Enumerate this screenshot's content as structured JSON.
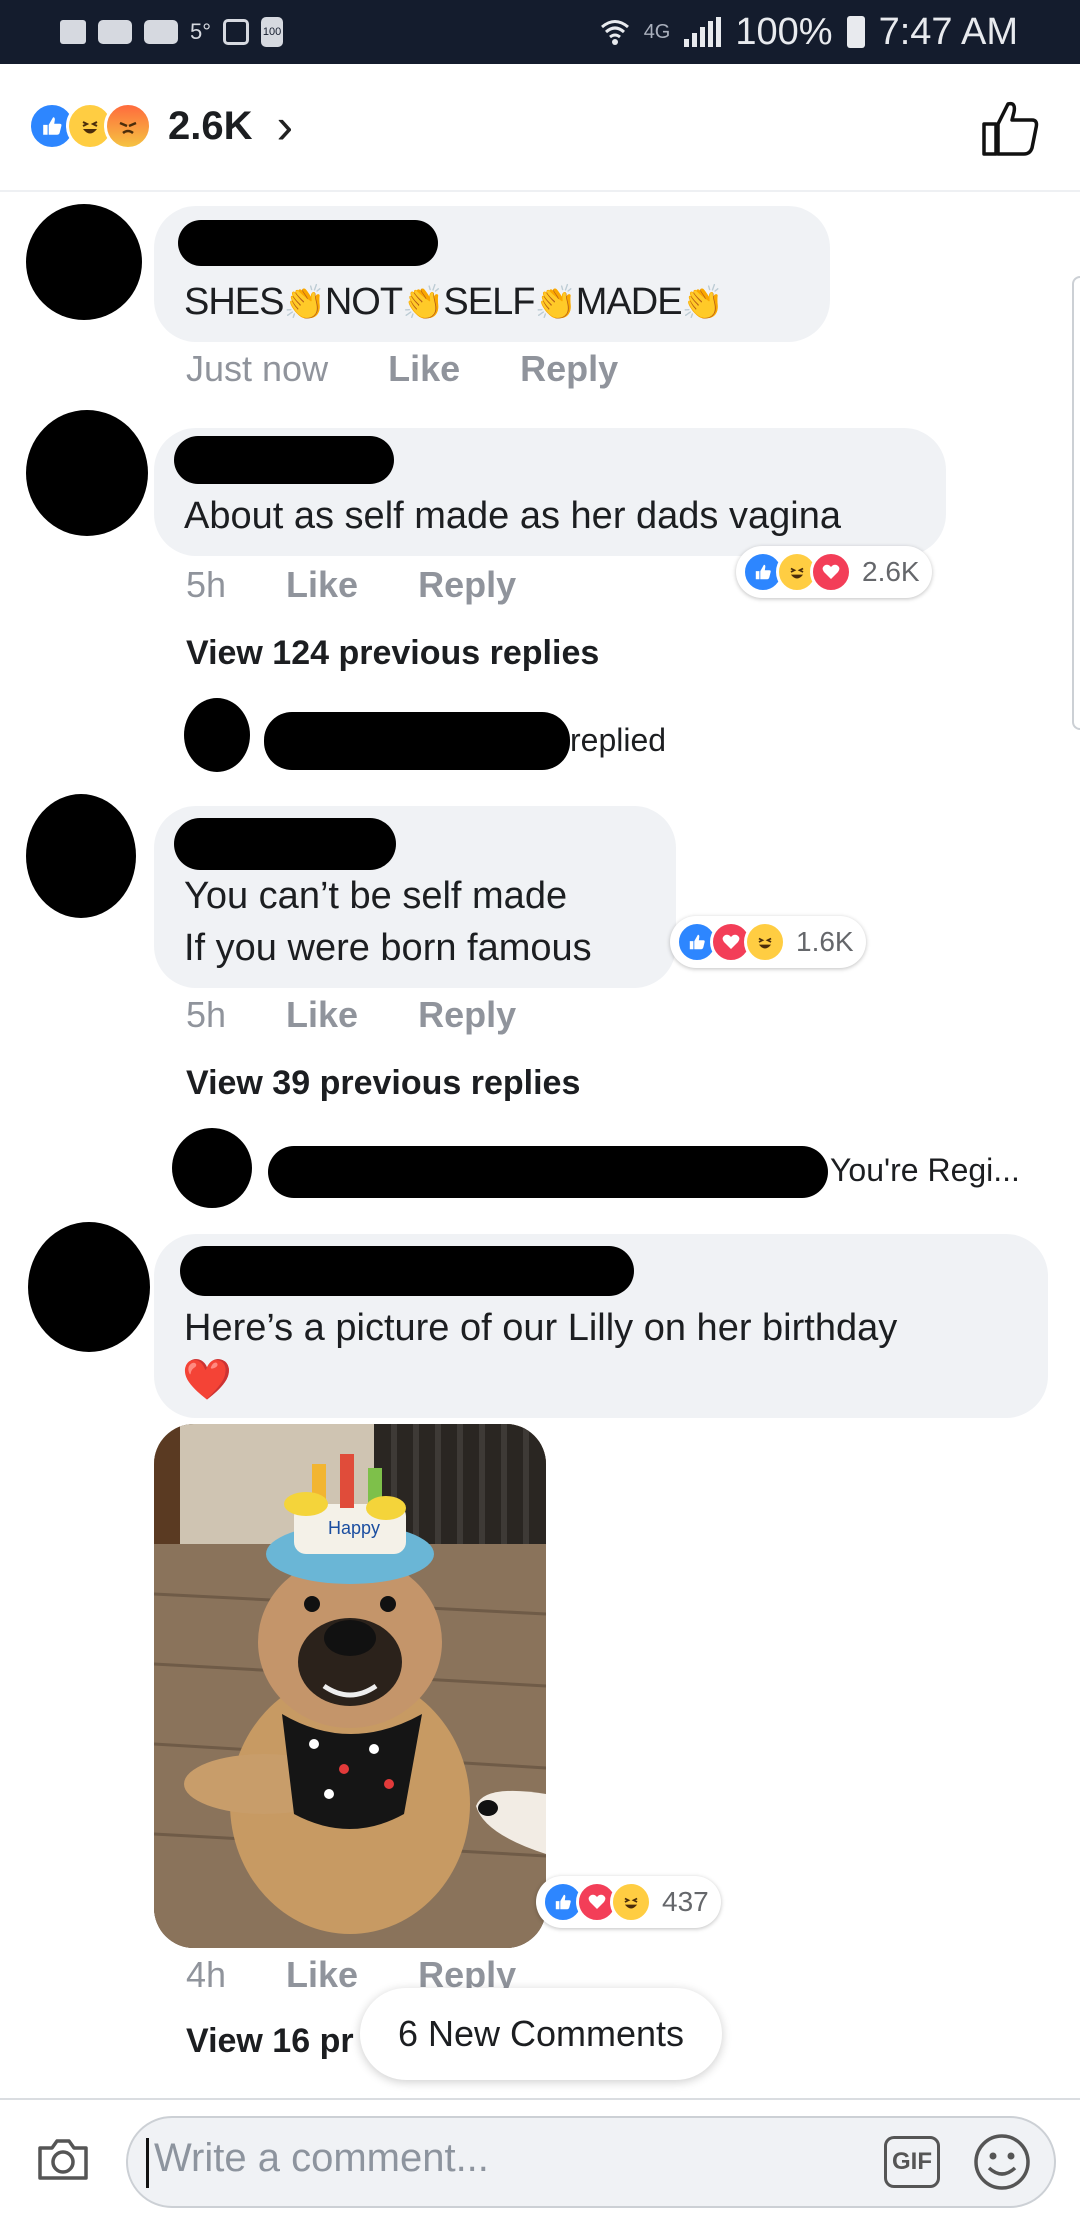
{
  "status_bar": {
    "temperature": "5°",
    "battery_small": "100",
    "network": "4G",
    "battery_percent": "100%",
    "time": "7:47 AM"
  },
  "reactions_header": {
    "count": "2.6K",
    "icons": [
      "like-icon",
      "haha-icon",
      "angry-icon"
    ]
  },
  "comments": [
    {
      "words": [
        "SHES",
        "NOT",
        "SELF",
        "MADE"
      ],
      "clap": "👏",
      "time": "Just now",
      "like": "Like",
      "reply": "Reply"
    },
    {
      "text": "About as self made as her dads vagina",
      "time": "5h",
      "like": "Like",
      "reply": "Reply",
      "reaction_count": "2.6K",
      "view_previous": "View 124 previous replies",
      "reply_snippet": "replied"
    },
    {
      "lines": [
        "You can’t be self made",
        "If you were born famous"
      ],
      "time": "5h",
      "like": "Like",
      "reply": "Reply",
      "reaction_count": "1.6K",
      "view_previous": "View 39 previous replies",
      "reply_snippet": "You're Regi..."
    },
    {
      "text": "Here’s a picture of our Lilly on her birthday",
      "heart": "❤️",
      "photo_hat_text": "Happy",
      "reaction_count": "437",
      "time": "4h",
      "like": "Like",
      "reply": "Reply",
      "view_previous": "View 16 pr"
    }
  ],
  "toast": "6 New Comments",
  "composer": {
    "placeholder": "Write a comment...",
    "gif_label": "GIF"
  },
  "colors": {
    "like_blue": "#2d86ff",
    "love_red": "#f33e58",
    "haha_yellow": "#ffcd42",
    "bubble_gray": "#f0f2f5"
  }
}
